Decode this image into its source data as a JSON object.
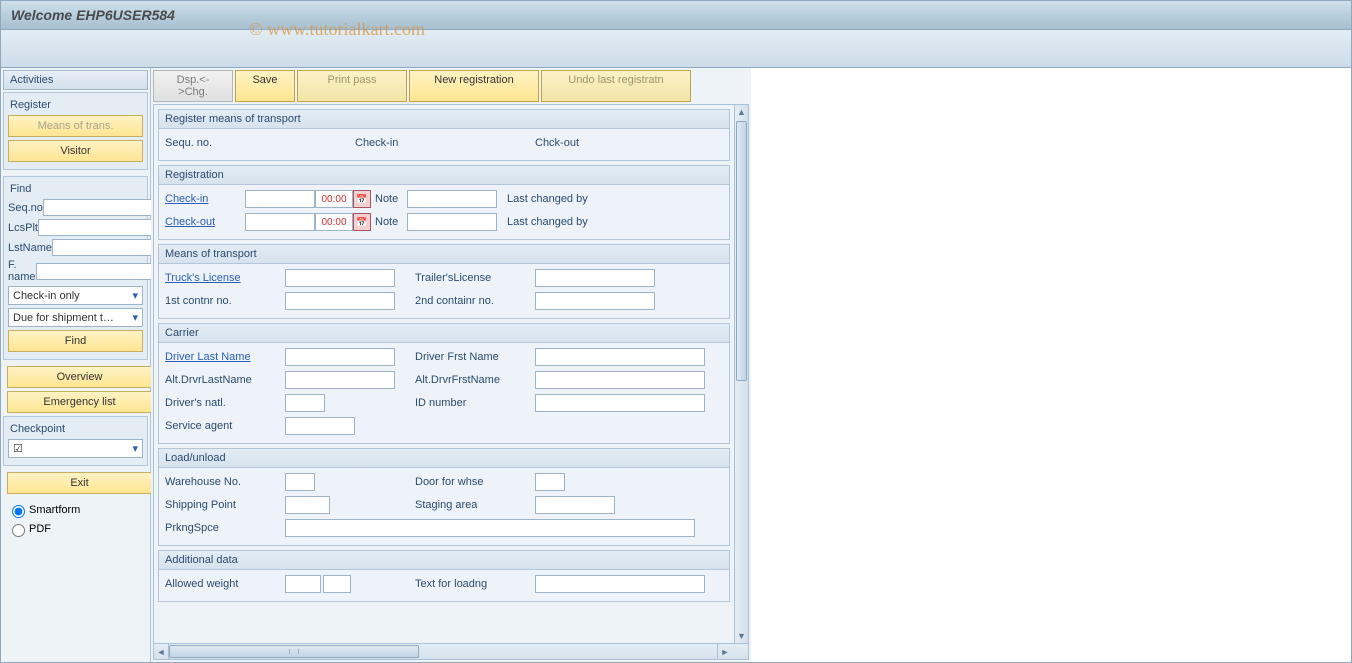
{
  "header": {
    "title": "Welcome  EHP6USER584",
    "watermark": "© www.tutorialkart.com"
  },
  "sidebar": {
    "title": "Activities",
    "register": {
      "header": "Register",
      "means_btn": "Means of trans.",
      "visitor_btn": "Visitor"
    },
    "find": {
      "header": "Find",
      "seq_label": "Seq.no",
      "lcsplt_label": "LcsPlt",
      "lstname_label": "LstName",
      "fname_label": "F. name",
      "select1": "Check-in only",
      "select2": "Due for shipment t…",
      "find_btn": "Find"
    },
    "overview_btn": "Overview",
    "emergency_btn": "Emergency list",
    "checkpoint": {
      "header": "Checkpoint",
      "value": "☑"
    },
    "exit_btn": "Exit",
    "radio": {
      "smartform": "Smartform",
      "pdf": "PDF"
    }
  },
  "toolbar": {
    "dspchg": "Dsp.<->Chg.",
    "save": "Save",
    "printpass": "Print pass",
    "newreg": "New registration",
    "undo": "Undo last registratn"
  },
  "groups": {
    "regmeans": {
      "title": "Register means of transport",
      "seq": "Sequ. no.",
      "checkin": "Check-in",
      "chckout": "Chck-out"
    },
    "registration": {
      "title": "Registration",
      "checkin": "Check-in",
      "checkout": "Check-out",
      "time": "00:00",
      "note": "Note",
      "lastchanged": "Last changed by"
    },
    "means": {
      "title": "Means of transport",
      "truck": "Truck's License",
      "trailer": "Trailer'sLicense",
      "cont1": "1st contnr no.",
      "cont2": "2nd containr no."
    },
    "carrier": {
      "title": "Carrier",
      "drvlast": "Driver Last Name",
      "drvfirst": "Driver Frst Name",
      "altlast": "Alt.DrvrLastName",
      "altfirst": "Alt.DrvrFrstName",
      "natl": "Driver's natl.",
      "idnum": "ID number",
      "svcagent": "Service agent"
    },
    "load": {
      "title": "Load/unload",
      "whse": "Warehouse No.",
      "door": "Door for whse",
      "shp": "Shipping Point",
      "staging": "Staging area",
      "prkng": "PrkngSpce"
    },
    "additional": {
      "title": "Additional data",
      "allowed": "Allowed weight",
      "textload": "Text for loadng"
    }
  }
}
